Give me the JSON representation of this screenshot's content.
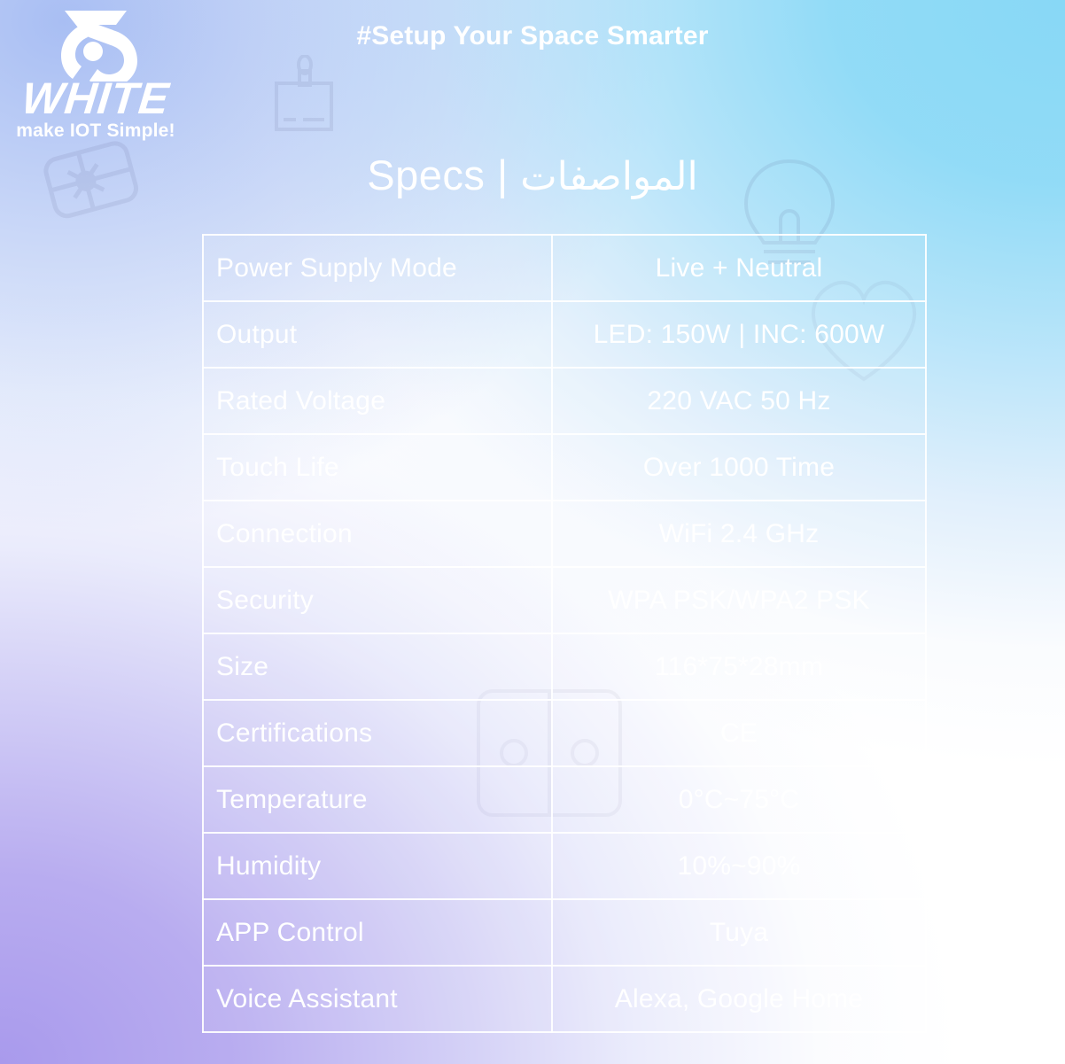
{
  "brand": {
    "logo_icon": "white-swirl-logo-icon",
    "name": "WHITE",
    "tagline": "make IOT Simple!"
  },
  "header": {
    "hashtag_tagline": "#Setup Your Space Smarter"
  },
  "title": {
    "english": "Specs",
    "separator": "|",
    "arabic": "المواصفات"
  },
  "colors": {
    "text": "#ffffff",
    "bg_top_left": "#93aef0",
    "bg_top_right": "#8bd8f5",
    "bg_bottom_left": "#a798ec",
    "bg_bottom_right": "#9cb8f2",
    "cell_border": "#ffffff"
  },
  "watermarks": [
    "gift-box-icon",
    "wall-socket-icon",
    "light-bulb-icon",
    "heart-icon",
    "switch-panel-icon"
  ],
  "specs": {
    "rows": [
      {
        "key": "Power Supply Mode",
        "value": "Live + Neutral"
      },
      {
        "key": "Output",
        "value": "LED: 150W | INC: 600W"
      },
      {
        "key": "Rated Voltage",
        "value": "220 VAC 50 Hz"
      },
      {
        "key": "Touch Life",
        "value": "Over 1000 Time"
      },
      {
        "key": "Connection",
        "value": "WiFi 2.4 GHz"
      },
      {
        "key": "Security",
        "value": "WPA PSK/WPA2 PSK"
      },
      {
        "key": "Size",
        "value": "116*75*28mm"
      },
      {
        "key": "Certifications",
        "value": "CE"
      },
      {
        "key": "Temperature",
        "value": "0°C~75°C"
      },
      {
        "key": "Humidity",
        "value": "10%~90%"
      },
      {
        "key": "APP Control",
        "value": "Tuya"
      },
      {
        "key": "Voice Assistant",
        "value": "Alexa, Google Home"
      }
    ]
  }
}
